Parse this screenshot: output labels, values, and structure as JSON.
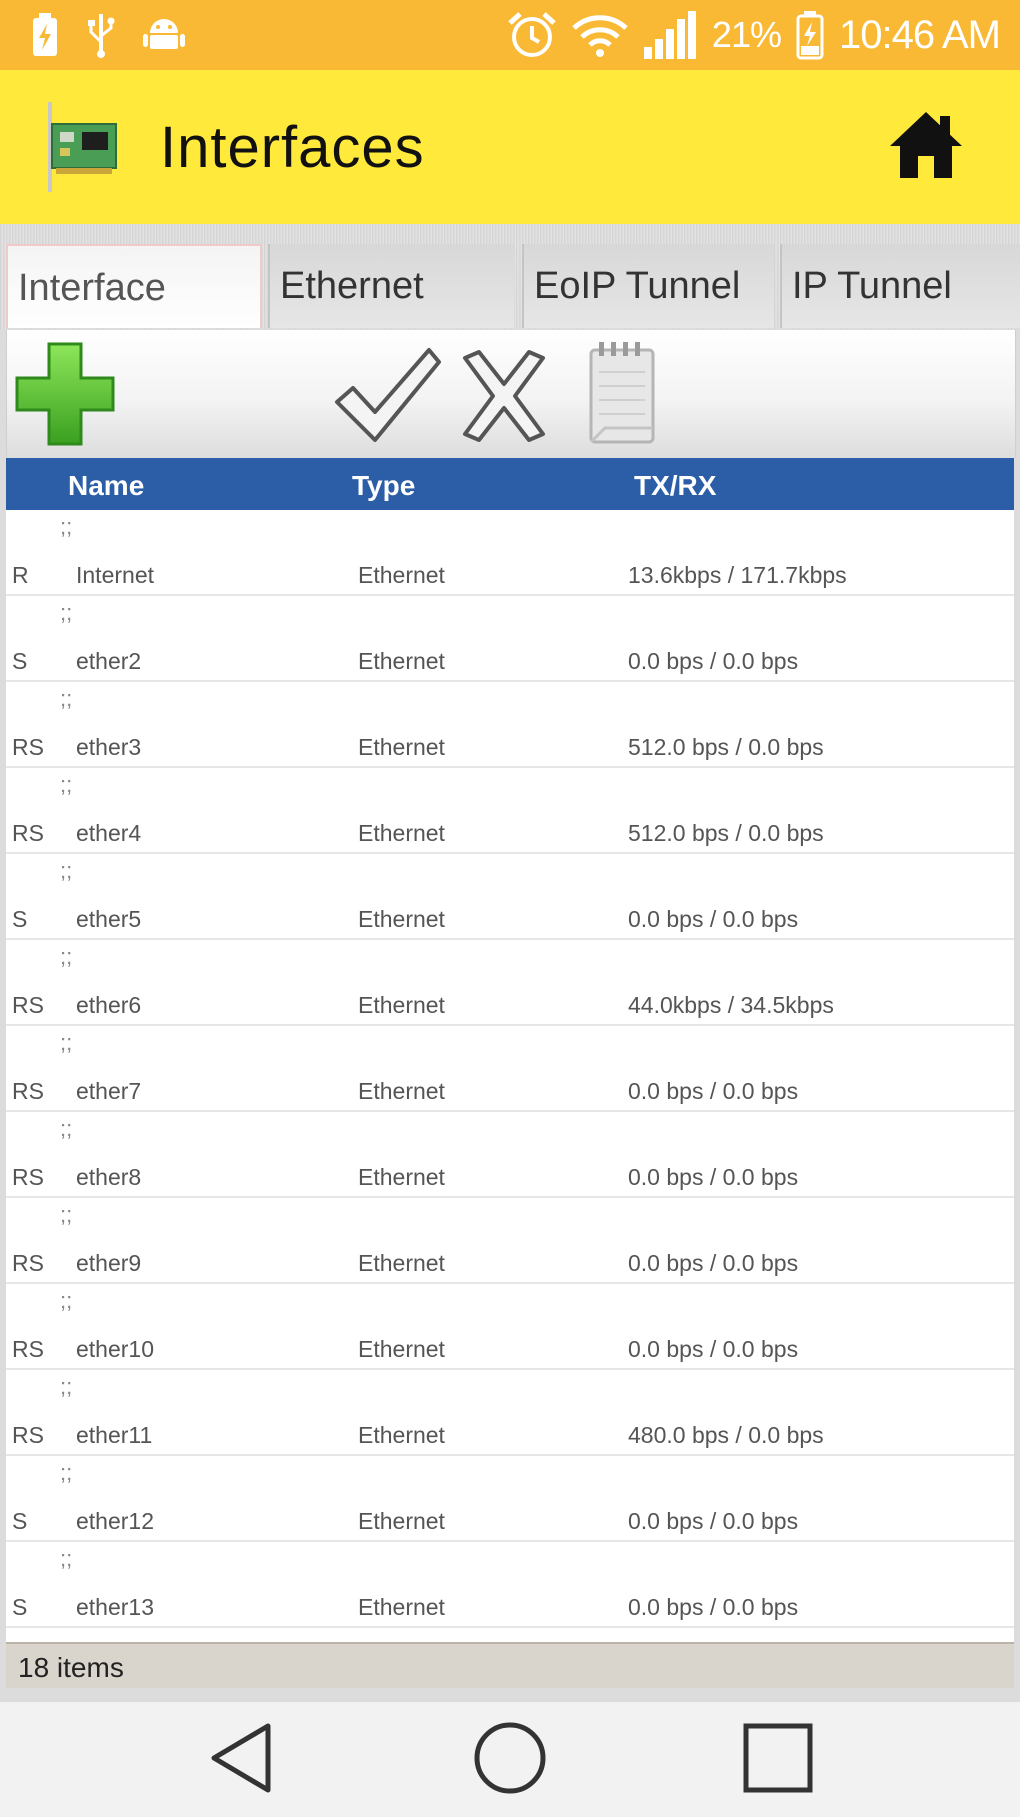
{
  "status_bar": {
    "battery_percent": "21%",
    "time": "10:46 AM",
    "icons": [
      "battery-saver-icon",
      "usb-icon",
      "android-debug-icon",
      "alarm-icon",
      "wifi-icon",
      "signal-icon",
      "battery-icon"
    ]
  },
  "app_bar": {
    "title": "Interfaces",
    "icons": [
      "network-card-icon",
      "home-icon"
    ]
  },
  "tabs": [
    {
      "label": "Interface",
      "active": true
    },
    {
      "label": "Ethernet",
      "active": false
    },
    {
      "label": "EoIP Tunnel",
      "active": false
    },
    {
      "label": "IP Tunnel",
      "active": false
    }
  ],
  "toolbar": {
    "icons": [
      "add-icon",
      "enable-check-icon",
      "disable-x-icon",
      "comment-notepad-icon"
    ]
  },
  "table": {
    "columns": [
      "Name",
      "Type",
      "TX/RX"
    ],
    "rows": [
      {
        "flag": "R",
        "name": "Internet",
        "type": "Ethernet",
        "txrx": "13.6kbps / 171.7kbps"
      },
      {
        "flag": "S",
        "name": "ether2",
        "type": "Ethernet",
        "txrx": "0.0 bps / 0.0 bps"
      },
      {
        "flag": "RS",
        "name": "ether3",
        "type": "Ethernet",
        "txrx": "512.0 bps / 0.0 bps"
      },
      {
        "flag": "RS",
        "name": "ether4",
        "type": "Ethernet",
        "txrx": "512.0 bps / 0.0 bps"
      },
      {
        "flag": "S",
        "name": "ether5",
        "type": "Ethernet",
        "txrx": "0.0 bps / 0.0 bps"
      },
      {
        "flag": "RS",
        "name": "ether6",
        "type": "Ethernet",
        "txrx": "44.0kbps / 34.5kbps"
      },
      {
        "flag": "RS",
        "name": "ether7",
        "type": "Ethernet",
        "txrx": "0.0 bps / 0.0 bps"
      },
      {
        "flag": "RS",
        "name": "ether8",
        "type": "Ethernet",
        "txrx": "0.0 bps / 0.0 bps"
      },
      {
        "flag": "RS",
        "name": "ether9",
        "type": "Ethernet",
        "txrx": "0.0 bps / 0.0 bps"
      },
      {
        "flag": "RS",
        "name": "ether10",
        "type": "Ethernet",
        "txrx": "0.0 bps / 0.0 bps"
      },
      {
        "flag": "RS",
        "name": "ether11",
        "type": "Ethernet",
        "txrx": "480.0 bps / 0.0 bps"
      },
      {
        "flag": "S",
        "name": "ether12",
        "type": "Ethernet",
        "txrx": "0.0 bps / 0.0 bps"
      },
      {
        "flag": "S",
        "name": "ether13",
        "type": "Ethernet",
        "txrx": "0.0 bps / 0.0 bps"
      }
    ],
    "row_handle": ";;"
  },
  "footer": {
    "items_label": "18 items"
  },
  "nav_bar": {
    "icons": [
      "back-icon",
      "home-circle-icon",
      "recents-icon"
    ]
  },
  "colors": {
    "status_bar": "#f9b934",
    "app_bar": "#ffea3c",
    "table_header": "#2c5ea8",
    "footer": "#dad5cc"
  }
}
